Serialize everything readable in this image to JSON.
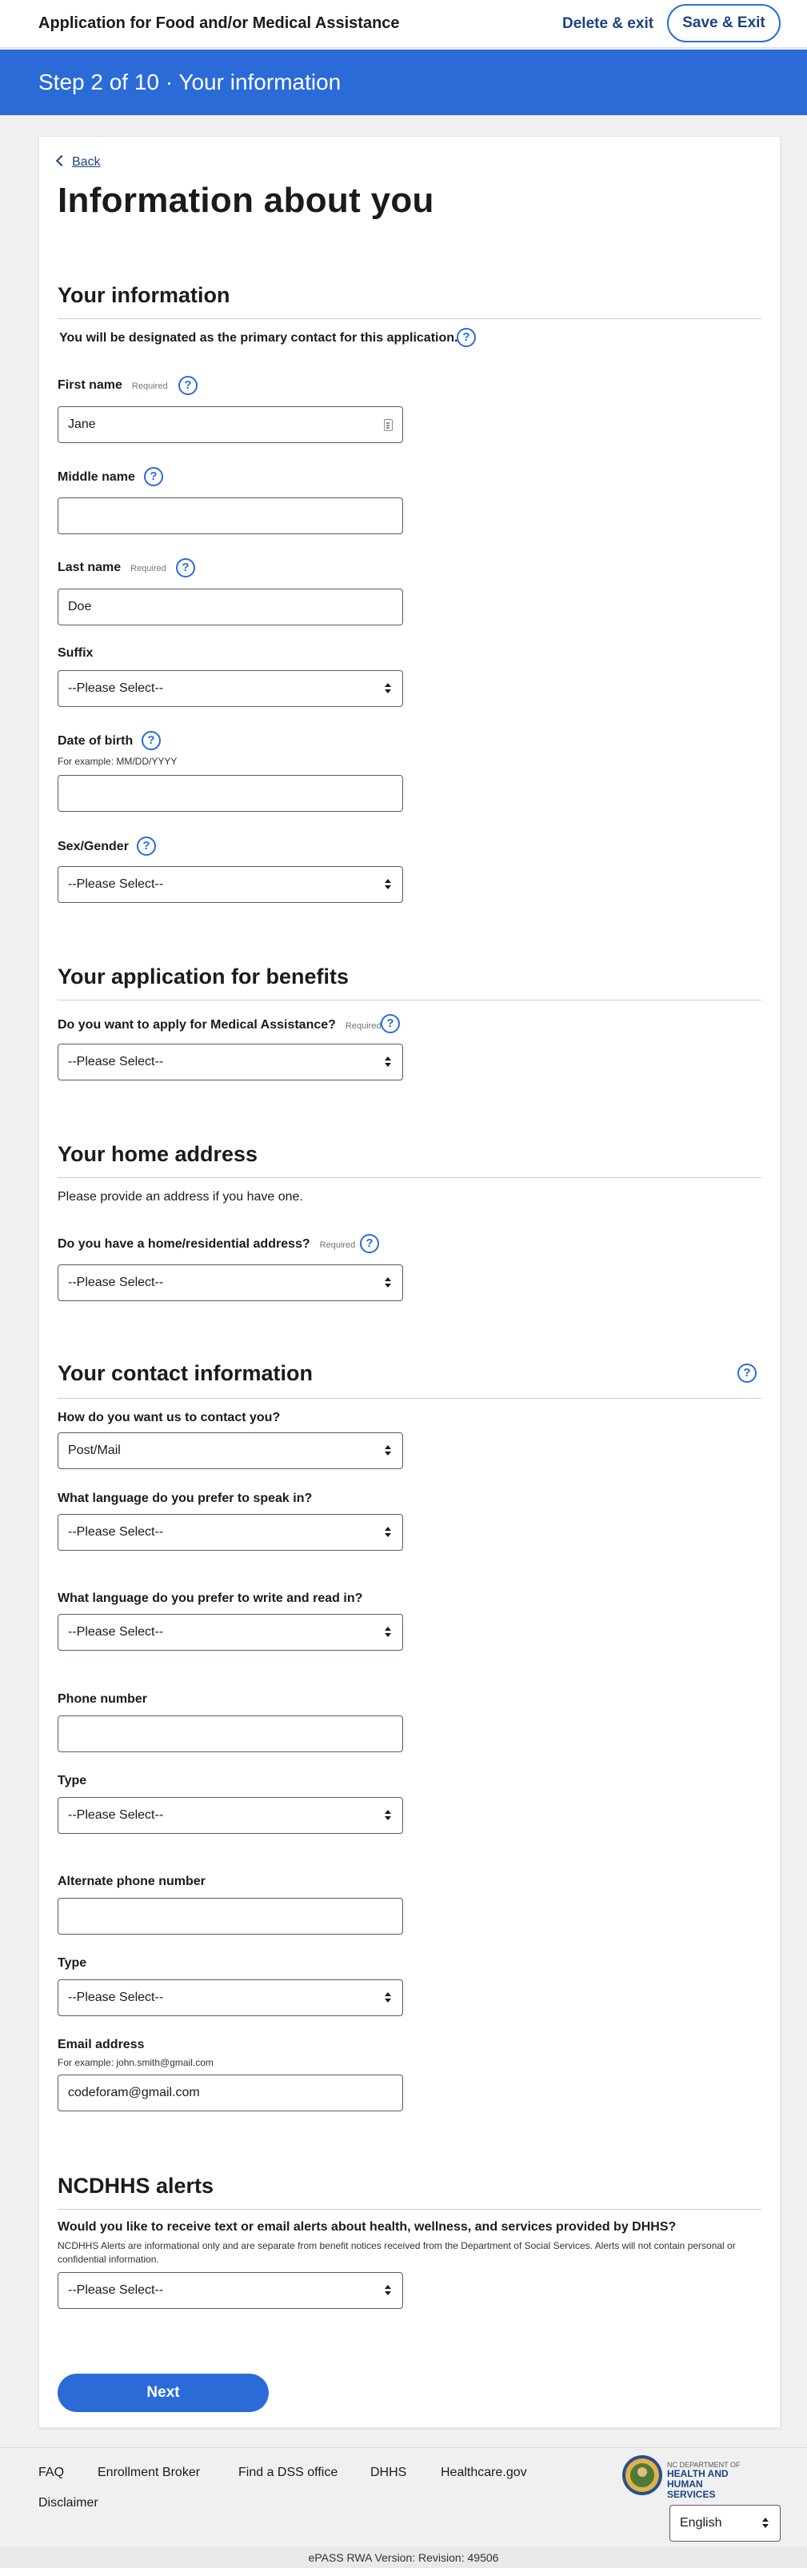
{
  "header": {
    "title": "Application for Food and/or Medical Assistance",
    "delete_exit": "Delete & exit",
    "save_exit": "Save & Exit"
  },
  "step_banner": "Step 2 of 10 · Your information",
  "back": "Back",
  "page_title": "Information about you",
  "help_glyph": "?",
  "required_text": "Required",
  "select_placeholder": "--Please Select--",
  "your_info": {
    "heading": "Your information",
    "note": "You will be designated as the primary contact for this application.",
    "first_name_label": "First name",
    "first_name_value": "Jane",
    "middle_name_label": "Middle name",
    "middle_name_value": "",
    "last_name_label": "Last name",
    "last_name_value": "Doe",
    "suffix_label": "Suffix",
    "dob_label": "Date of birth",
    "dob_hint": "For example: MM/DD/YYYY",
    "dob_value": "",
    "sex_label": "Sex/Gender"
  },
  "benefits": {
    "heading": "Your application for benefits",
    "medical_label": "Do you want to apply for Medical Assistance?"
  },
  "home_address": {
    "heading": "Your home address",
    "note": "Please provide an address if you have one.",
    "residential_label": "Do you have a home/residential address?"
  },
  "contact": {
    "heading": "Your contact information",
    "contact_method_label": "How do you want us to contact you?",
    "contact_method_value": "Post/Mail",
    "speak_lang_label": "What language do you prefer to speak in?",
    "write_lang_label": "What language do you prefer to write and read in?",
    "phone_label": "Phone number",
    "phone_value": "",
    "phone_type_label": "Type",
    "alt_phone_label": "Alternate phone number",
    "alt_phone_value": "",
    "alt_phone_type_label": "Type",
    "email_label": "Email address",
    "email_hint": "For example: john.smith@gmail.com",
    "email_value": "codeforam@gmail.com"
  },
  "alerts": {
    "heading": "NCDHHS alerts",
    "question": "Would you like to receive text or email alerts about health, wellness, and services provided by DHHS?",
    "disclaimer": "NCDHHS Alerts are informational only and are separate from benefit notices received from the Department of Social Services. Alerts will not contain personal or confidential information."
  },
  "next_button": "Next",
  "footer": {
    "links": [
      "FAQ",
      "Enrollment Broker",
      "Find a DSS office",
      "DHHS",
      "Healthcare.gov",
      "Disclaimer"
    ],
    "logo_text": [
      "NC DEPARTMENT OF",
      "HEALTH AND",
      "HUMAN SERVICES"
    ],
    "language_value": "English",
    "revision": "ePASS RWA Version: Revision: 49506"
  },
  "colors": {
    "primary": "#2b6bd8",
    "link": "#1a4480"
  }
}
